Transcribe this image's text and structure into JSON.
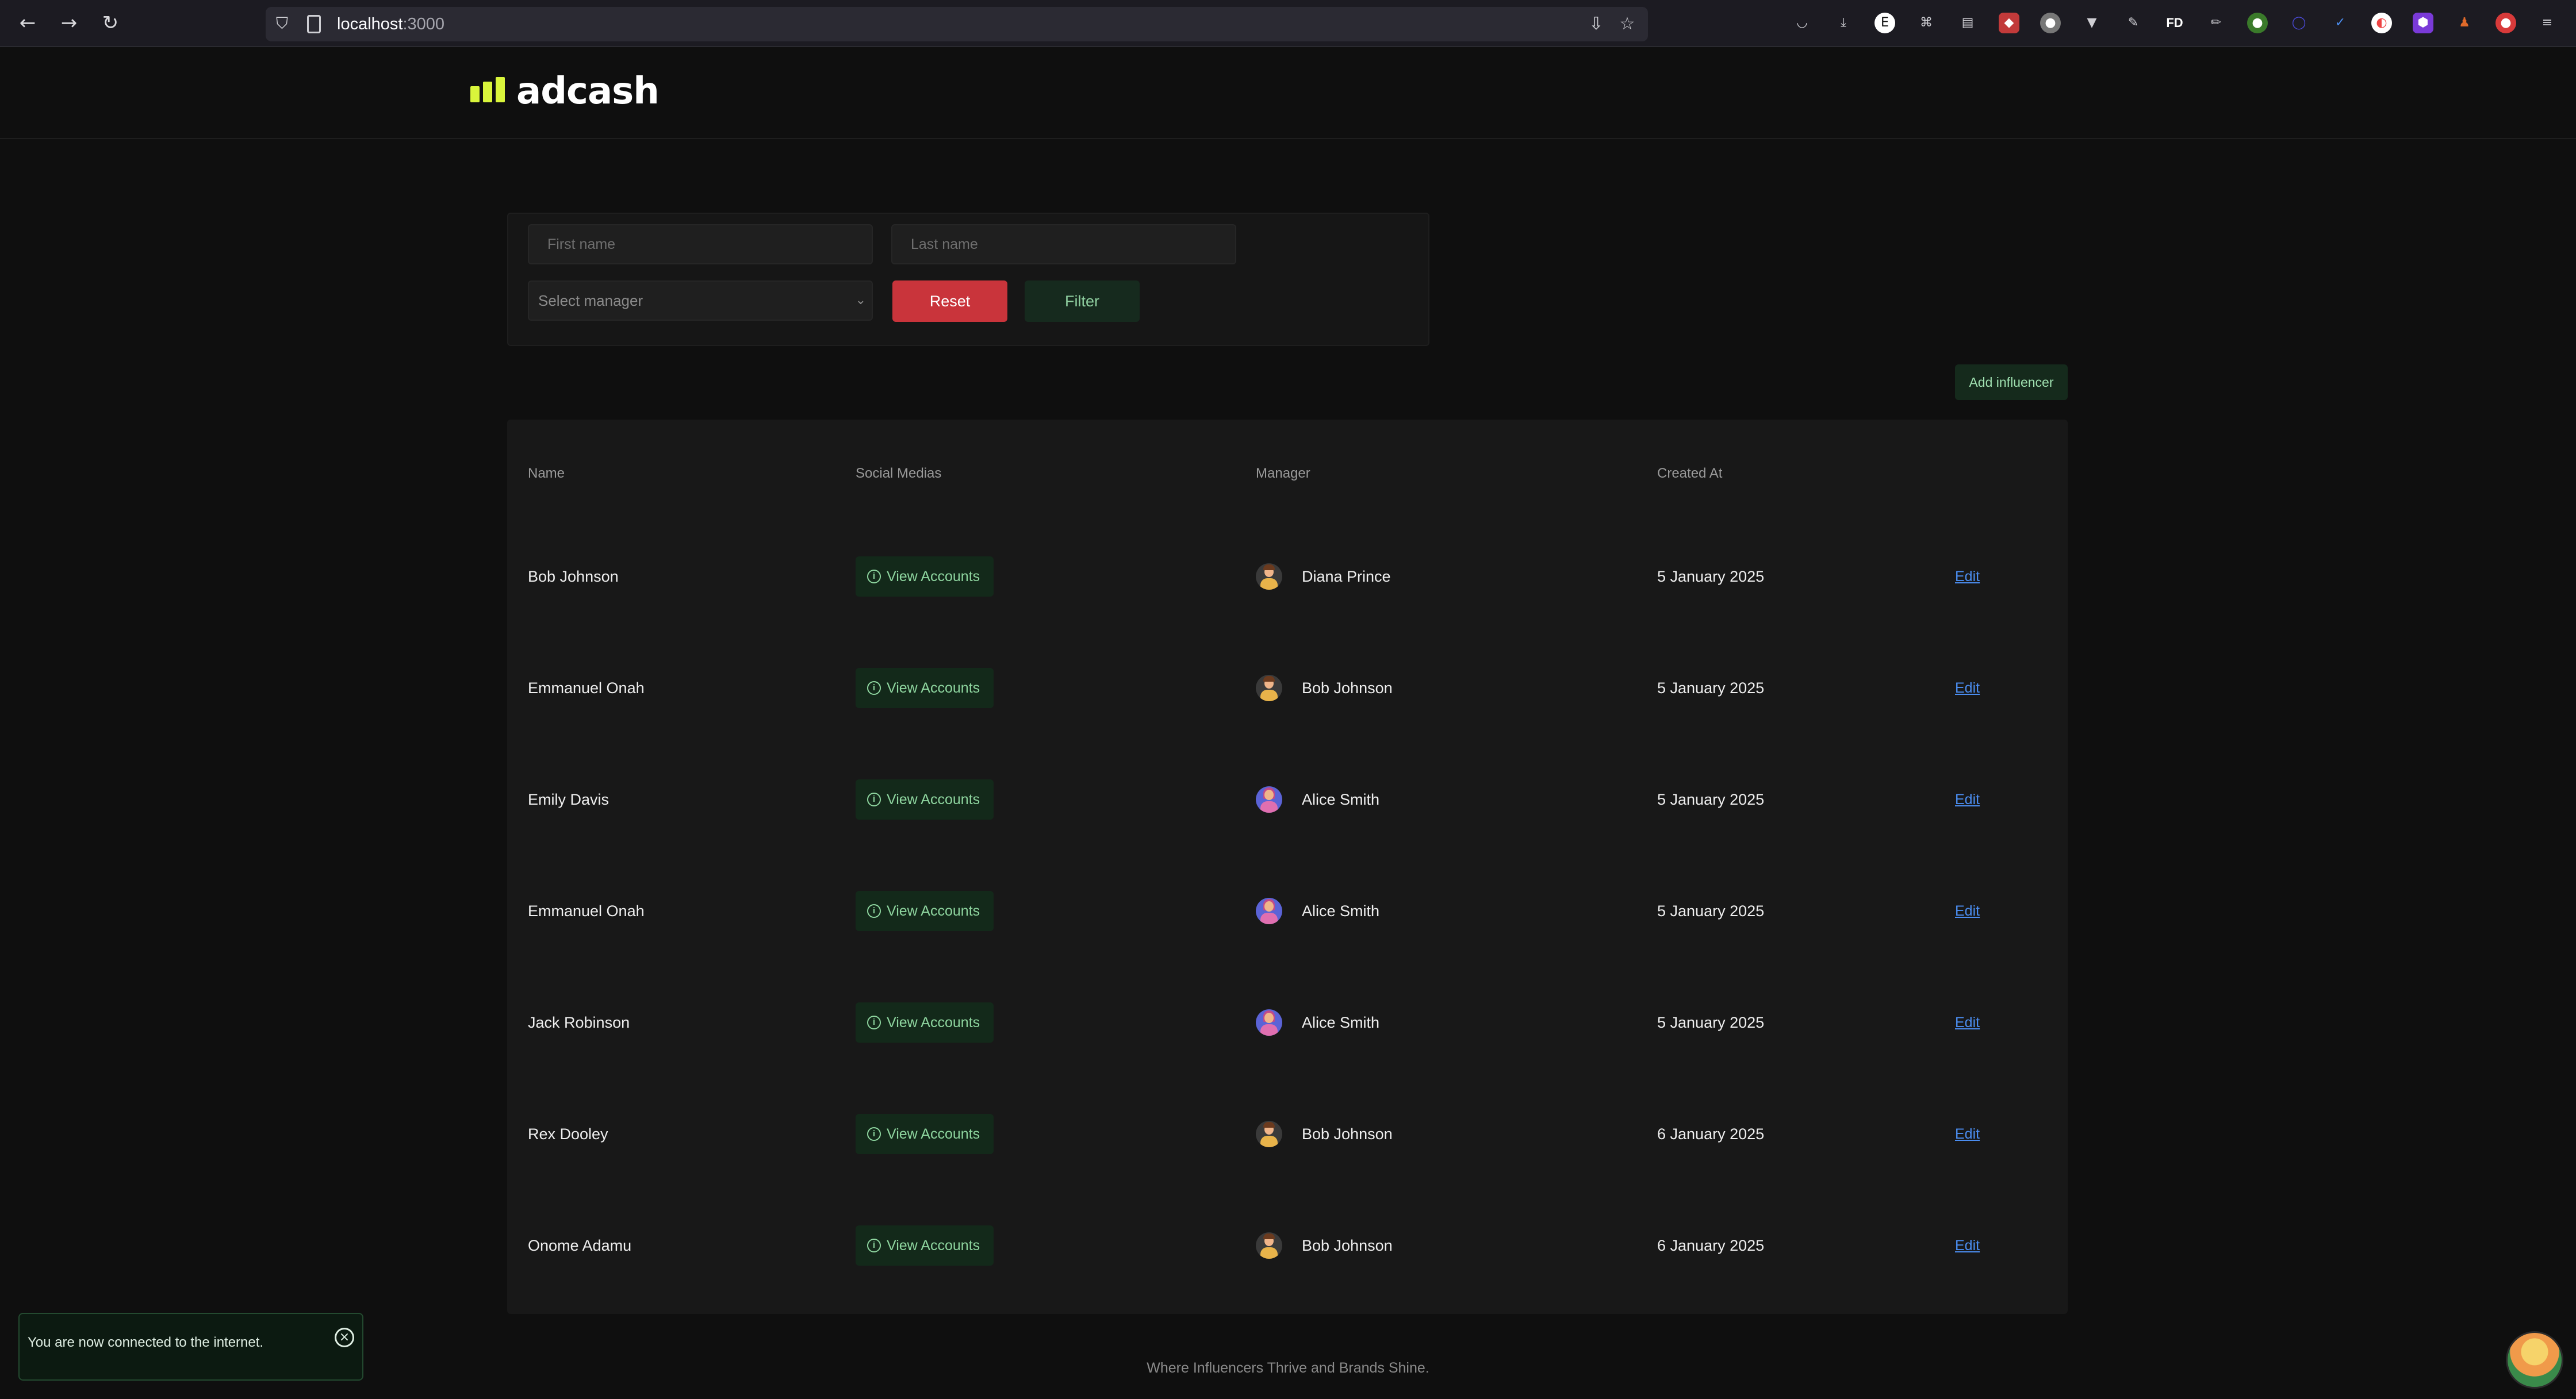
{
  "browser": {
    "url_host": "localhost",
    "url_port": ":3000",
    "ext_fd": "FD"
  },
  "header": {
    "logo_text": "adcash",
    "logo_color": "#d9f53b"
  },
  "filters": {
    "first_name_placeholder": "First name",
    "last_name_placeholder": "Last name",
    "manager_placeholder": "Select manager",
    "reset_label": "Reset",
    "filter_label": "Filter"
  },
  "add_button_label": "Add influencer",
  "table": {
    "columns": [
      "Name",
      "Social Medias",
      "Manager",
      "Created At"
    ],
    "view_accounts_label": "View Accounts",
    "edit_label": "Edit",
    "rows": [
      {
        "name": "Bob Johnson",
        "manager": "Diana Prince",
        "created_at": "5 January 2025",
        "avatar": "avatar-man-icon"
      },
      {
        "name": "Emmanuel Onah",
        "manager": "Bob Johnson",
        "created_at": "5 January 2025",
        "avatar": "avatar-man-icon"
      },
      {
        "name": "Emily Davis",
        "manager": "Alice Smith",
        "created_at": "5 January 2025",
        "avatar": "avatar-woman-icon"
      },
      {
        "name": "Emmanuel Onah",
        "manager": "Alice Smith",
        "created_at": "5 January 2025",
        "avatar": "avatar-woman-icon"
      },
      {
        "name": "Jack Robinson",
        "manager": "Alice Smith",
        "created_at": "5 January 2025",
        "avatar": "avatar-woman-icon"
      },
      {
        "name": "Rex Dooley",
        "manager": "Bob Johnson",
        "created_at": "6 January 2025",
        "avatar": "avatar-man-icon"
      },
      {
        "name": "Onome Adamu",
        "manager": "Bob Johnson",
        "created_at": "6 January 2025",
        "avatar": "avatar-man-icon"
      }
    ]
  },
  "footer_text": "Where Influencers Thrive and Brands Shine.",
  "toast_message": "You are now connected to the internet."
}
